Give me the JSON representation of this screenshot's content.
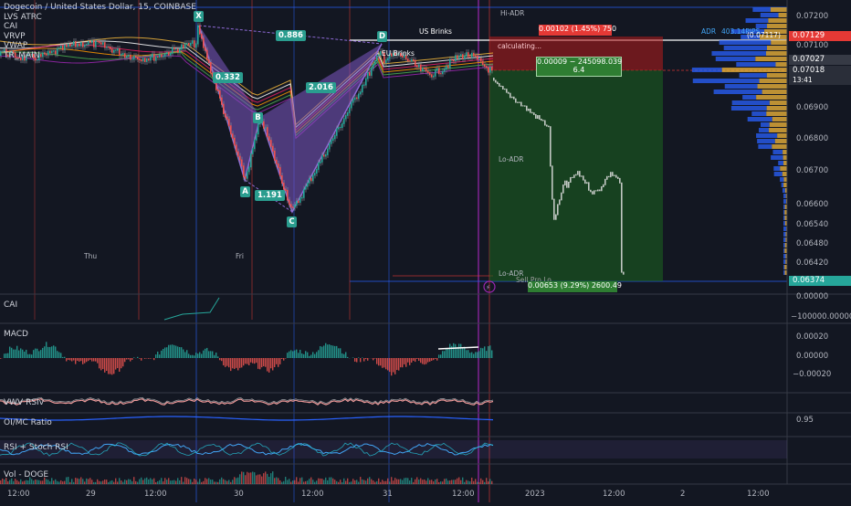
{
  "symbol_title": "Dogecoin / United States Dollar, 15, COINBASE",
  "indicators": [
    "LVS ATRC",
    "CAI",
    "VRVP",
    "VWAP",
    "TR_MAIN"
  ],
  "harmonic": {
    "points": [
      "X",
      "A",
      "B",
      "C",
      "D"
    ],
    "ratios": [
      "0.886",
      "0.332",
      "2.016",
      "1.191"
    ]
  },
  "annotations": {
    "hi_adr": "Hi-ADR",
    "lo_adr_1": "Lo-ADR",
    "lo_adr_2": "Lo-ADR",
    "adr": "ADR",
    "adr_value": "403.14PIPS",
    "eu_brinks": "EU Brinks",
    "us_brinks": "US Brinks",
    "calculating": "calculating...",
    "vwap_tag": "VWAP",
    "sell": "Sell Pro Lo"
  },
  "position": {
    "stop_label": "0.00102 (1.45%) 750",
    "entry_label_1": "0.00009 − 245098.039",
    "entry_label_2": "6.4",
    "target_label": "0.00653 (9.29%) 2600.49"
  },
  "price_axis": {
    "ticks": [
      "0.07200",
      "0.07100",
      "0.06900",
      "0.06800",
      "0.06700",
      "0.06600",
      "0.06540",
      "0.06480",
      "0.06420"
    ],
    "tag_top": "0.07129",
    "tag_mid_1": "0.07027",
    "tag_mid_2": "0.07018",
    "tag_time": "13:41",
    "tag_bottom": "0.06374",
    "tag_vwap": "(0.07117)"
  },
  "cai_pane": {
    "label": "CAI",
    "ticks": [
      "0.00000",
      "−100000.00000"
    ]
  },
  "macd_pane": {
    "label": "MACD",
    "ticks": [
      "0.00020",
      "0.00000",
      "−0.00020"
    ]
  },
  "vwv_pane": {
    "label": "VWV RSIv"
  },
  "oi_pane": {
    "label": "OI/MC Ratio",
    "tick": "0.95"
  },
  "rsi_pane": {
    "label": "RSI + Stoch RSI"
  },
  "vol_pane": {
    "label": "Vol - DOGE"
  },
  "time_axis": [
    "12:00",
    "29",
    "12:00",
    "30",
    "12:00",
    "31",
    "12:00",
    "2023",
    "12:00",
    "2",
    "12:00"
  ],
  "day_labels": [
    "Thu",
    "Fri"
  ],
  "colors": {
    "background": "#131722",
    "harmonic_fill": "#7e57c2",
    "profit_zone": "#1b5e20",
    "stop_zone": "#b71c1c",
    "tag_red": "#e53935",
    "tag_green": "#26a69a",
    "volume_profile_blue": "#2962ff",
    "volume_profile_orange": "#f6b93b"
  }
}
